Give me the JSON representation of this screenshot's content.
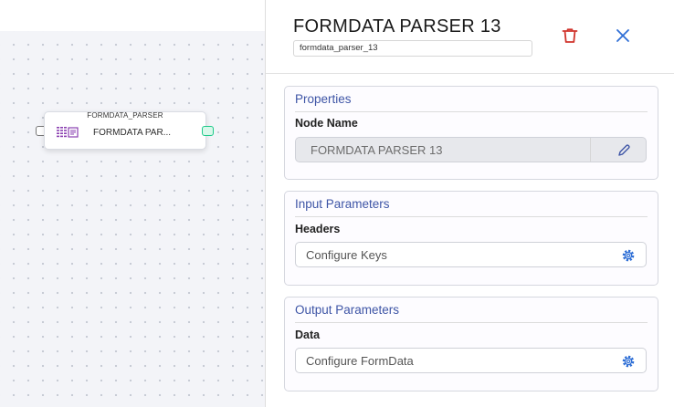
{
  "canvas": {
    "node": {
      "type_label": "FORMDATA_PARSER",
      "label": "FORMDATA PAR...",
      "icon": "formdata-icon"
    }
  },
  "panel": {
    "title": "FORMDATA PARSER 13",
    "node_id": "formdata_parser_13",
    "delete_icon": "trash-icon",
    "close_icon": "close-icon",
    "sections": {
      "properties": {
        "title": "Properties",
        "node_name_label": "Node Name",
        "node_name_value": "FORMDATA PARSER 13",
        "edit_icon": "pencil-icon"
      },
      "input": {
        "title": "Input Parameters",
        "headers_label": "Headers",
        "headers_value": "Configure Keys",
        "icon": "gear-icon"
      },
      "output": {
        "title": "Output Parameters",
        "data_label": "Data",
        "data_value": "Configure FormData",
        "icon": "gear-icon"
      }
    }
  },
  "colors": {
    "accent": "#3e55a6",
    "delete": "#d0342c",
    "close": "#2f6fd6",
    "port_out": "#1ec98a"
  }
}
